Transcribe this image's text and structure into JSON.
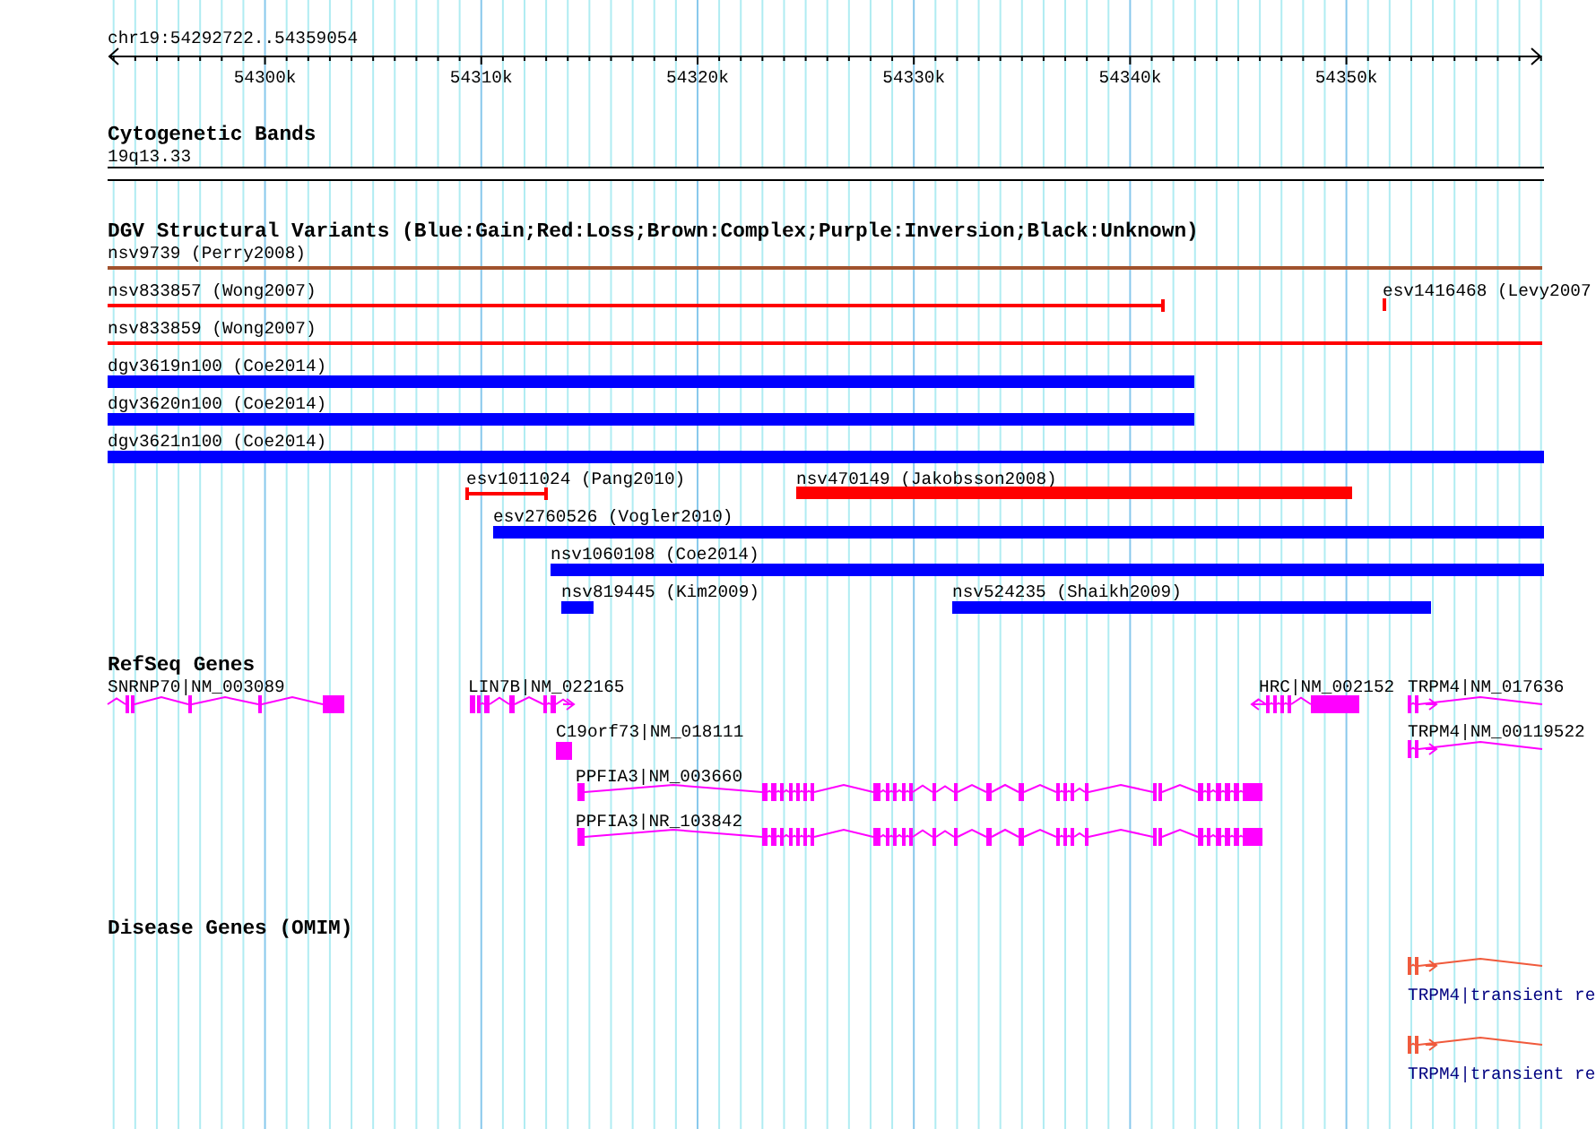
{
  "ruler": {
    "range": "chr19:54292722..54359054",
    "tick_labels": [
      "54300k",
      "54310k",
      "54320k",
      "54330k",
      "54340k",
      "54350k"
    ]
  },
  "cytogenetic_bands": {
    "title": "Cytogenetic Bands",
    "bands": [
      {
        "label": "19q13.33"
      }
    ]
  },
  "dgv": {
    "title": "DGV Structural Variants (Blue:Gain;Red:Loss;Brown:Complex;Purple:Inversion;Black:Unknown)",
    "features": [
      {
        "label": "nsv9739 (Perry2008)",
        "color": "#a0522d",
        "kind": "line"
      },
      {
        "label": "nsv833857 (Wong2007)",
        "color": "#ff0000",
        "kind": "line"
      },
      {
        "label": "esv1416468 (Levy2007",
        "color": "#ff0000",
        "kind": "bar"
      },
      {
        "label": "nsv833859 (Wong2007)",
        "color": "#ff0000",
        "kind": "line"
      },
      {
        "label": "dgv3619n100 (Coe2014)",
        "color": "#0000ff",
        "kind": "bar"
      },
      {
        "label": "dgv3620n100 (Coe2014)",
        "color": "#0000ff",
        "kind": "bar"
      },
      {
        "label": "dgv3621n100 (Coe2014)",
        "color": "#0000ff",
        "kind": "bar"
      },
      {
        "label": "esv1011024 (Pang2010)",
        "color": "#ff0000",
        "kind": "line"
      },
      {
        "label": "nsv470149 (Jakobsson2008)",
        "color": "#ff0000",
        "kind": "bar"
      },
      {
        "label": "esv2760526 (Vogler2010)",
        "color": "#0000ff",
        "kind": "bar"
      },
      {
        "label": "nsv1060108 (Coe2014)",
        "color": "#0000ff",
        "kind": "bar"
      },
      {
        "label": "nsv819445 (Kim2009)",
        "color": "#0000ff",
        "kind": "bar"
      },
      {
        "label": "nsv524235 (Shaikh2009)",
        "color": "#0000ff",
        "kind": "bar"
      }
    ]
  },
  "refseq_genes": {
    "title": "RefSeq Genes",
    "genes": [
      {
        "label": "SNRNP70|NM_003089"
      },
      {
        "label": "LIN7B|NM_022165"
      },
      {
        "label": "C19orf73|NM_018111"
      },
      {
        "label": "PPFIA3|NM_003660"
      },
      {
        "label": "PPFIA3|NR_103842"
      },
      {
        "label": "HRC|NM_002152"
      },
      {
        "label": "TRPM4|NM_017636"
      },
      {
        "label": "TRPM4|NM_00119522"
      }
    ]
  },
  "disease_genes": {
    "title": "Disease Genes (OMIM)",
    "genes": [
      {
        "label": "TRPM4|transient re"
      },
      {
        "label": "TRPM4|transient re"
      }
    ]
  }
}
